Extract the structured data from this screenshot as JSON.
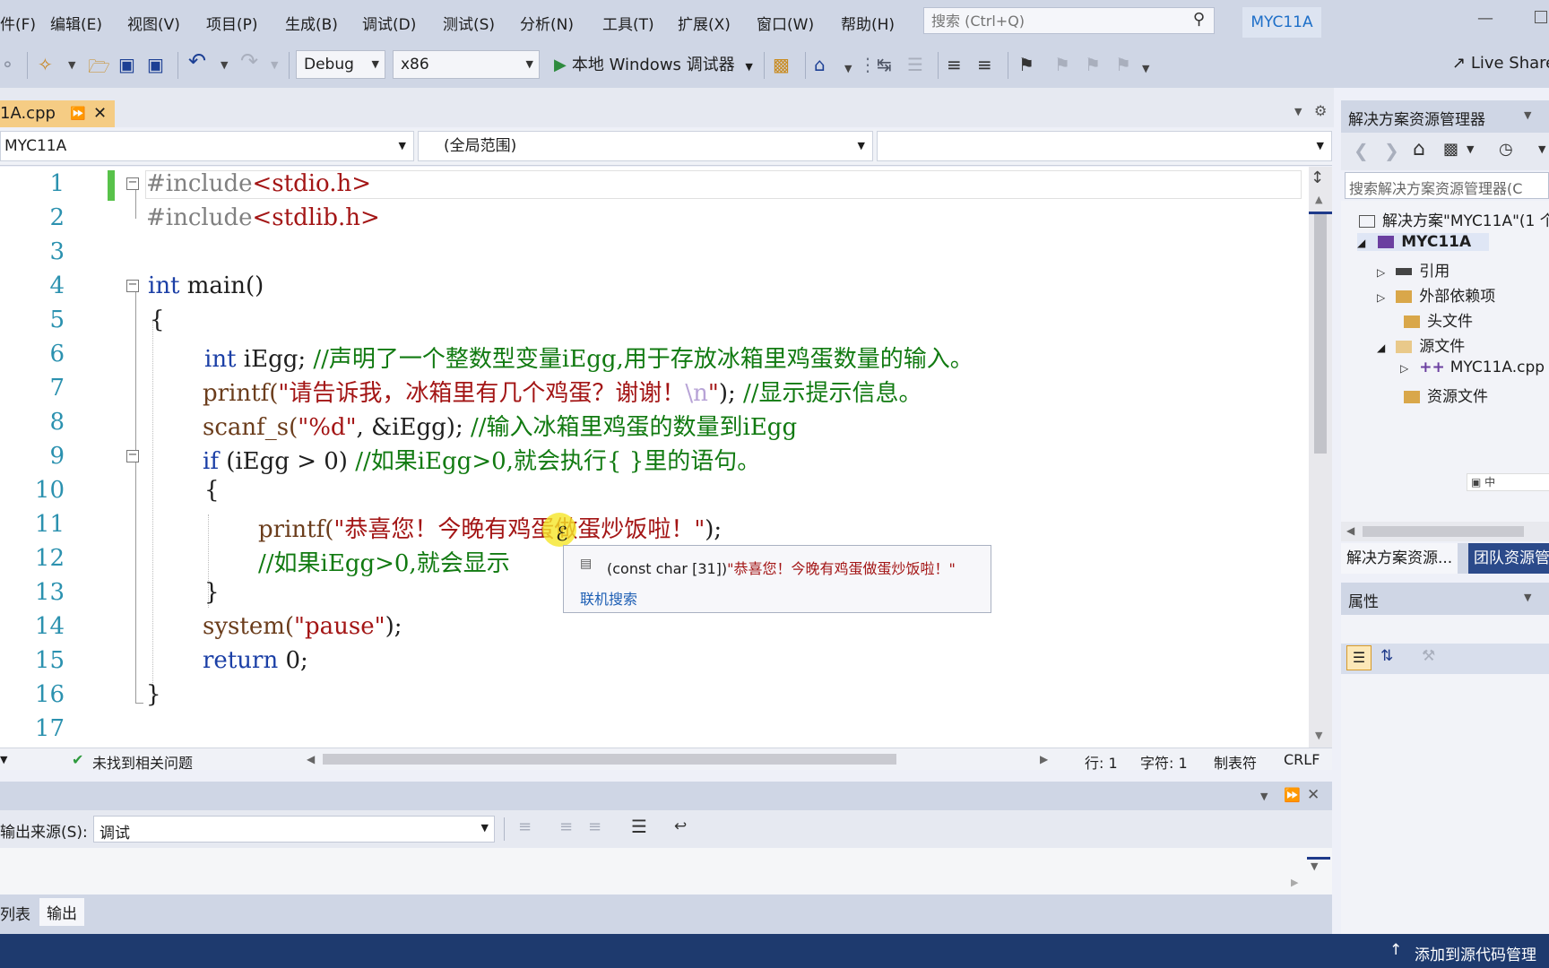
{
  "menu": [
    "件(F)",
    "编辑(E)",
    "视图(V)",
    "项目(P)",
    "生成(B)",
    "调试(D)",
    "测试(S)",
    "分析(N)",
    "工具(T)",
    "扩展(X)",
    "窗口(W)",
    "帮助(H)"
  ],
  "search": {
    "placeholder": "搜索 (Ctrl+Q)"
  },
  "project_badge": "MYC11A",
  "toolbar": {
    "config": "Debug",
    "platform": "x86",
    "run_label": "本地 Windows 调试器",
    "live_share": "Live Share"
  },
  "tab": {
    "file_name": "1A.cpp"
  },
  "nav": {
    "project": "MYC11A",
    "scope": "(全局范围)",
    "member": ""
  },
  "code_lines": [
    "1",
    "2",
    "3",
    "4",
    "5",
    "6",
    "7",
    "8",
    "9",
    "10",
    "11",
    "12",
    "13",
    "14",
    "15",
    "16",
    "17"
  ],
  "code": {
    "l1_dir": "#include",
    "l1_hdr": "<stdio.h>",
    "l2_dir": "#include",
    "l2_hdr": "<stdlib.h>",
    "l4_kw": "int",
    "l4_rest": " main()",
    "l5": "{",
    "l6_kw": "int",
    "l6_rest": " iEgg; ",
    "l6_cmt": "//声明了一个整数型变量iEgg,用于存放冰箱里鸡蛋数量的输入。",
    "l7_fn": "printf(",
    "l7_str": "\"请告诉我，冰箱里有几个鸡蛋？谢谢！",
    "l7_esc": "\\n",
    "l7_str2": "\"",
    "l7_rest": "); ",
    "l7_cmt": "//显示提示信息。",
    "l8_fn": "scanf_s(",
    "l8_str": "\"%d\"",
    "l8_rest": ", &iEgg); ",
    "l8_cmt": "//输入冰箱里鸡蛋的数量到iEgg",
    "l9_kw": "if",
    "l9_rest": " (iEgg > 0) ",
    "l9_cmt": "//如果iEgg>0,就会执行{ }里的语句。",
    "l10": "{",
    "l11_fn": "printf(",
    "l11_str": "\"恭喜您！今晚有鸡蛋做蛋炒饭啦！\"",
    "l11_rest": ");",
    "l12_cmt": "//如果iEgg>0,就会显示",
    "l13": "}",
    "l14_fn": "system(",
    "l14_str": "\"pause\"",
    "l14_rest": ");",
    "l15_kw": "return",
    "l15_rest": " 0;",
    "l16": "}"
  },
  "tooltip": {
    "signature": "(const char [31])",
    "value": "\"恭喜您！今晚有鸡蛋做蛋炒饭啦！\"",
    "link": "联机搜索"
  },
  "editor_status": {
    "issues": "未找到相关问题",
    "line": "行: 1",
    "char": "字符: 1",
    "tabs": "制表符",
    "eol": "CRLF"
  },
  "output": {
    "source_label": "输出来源(S):",
    "source_value": "调试"
  },
  "bottom_tabs": [
    "列表",
    "输出"
  ],
  "statusbar": {
    "source_control": "添加到源代码管理"
  },
  "solution_explorer": {
    "title": "解决方案资源管理器",
    "search_placeholder": "搜索解决方案资源管理器(C",
    "items": [
      {
        "label": "解决方案\"MYC11A\"(1 个"
      },
      {
        "label": "MYC11A"
      },
      {
        "label": "引用"
      },
      {
        "label": "外部依赖项"
      },
      {
        "label": "头文件"
      },
      {
        "label": "源文件"
      },
      {
        "label": "MYC11A.cpp"
      },
      {
        "label": "资源文件"
      }
    ],
    "tab_active": "解决方案资源...",
    "tab_other": "团队资源管",
    "ime_status": "中"
  },
  "properties": {
    "title": "属性"
  },
  "colors": {
    "accent": "#1e6fc8",
    "tab_active": "#f5cc84",
    "status_bar": "#1e3a6e",
    "keyword": "#1b3fa6",
    "string": "#a31515",
    "comment": "#117a11"
  }
}
